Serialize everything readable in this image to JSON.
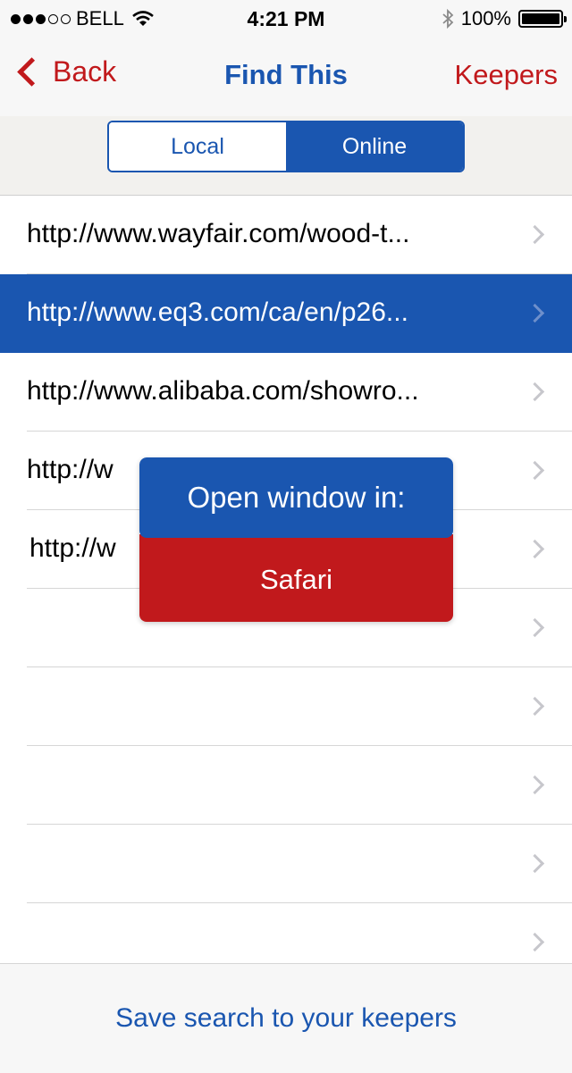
{
  "status_bar": {
    "carrier": "BELL",
    "time": "4:21 PM",
    "battery": "100%",
    "signal_bars_filled": 3,
    "signal_bars_total": 5
  },
  "nav": {
    "back_label": "Back",
    "title": "Find This",
    "keepers_label": "Keepers"
  },
  "segments": {
    "local": "Local",
    "online": "Online",
    "selected": "Online"
  },
  "list": {
    "rows": [
      {
        "url": "http://www.wayfair.com/wood-t..."
      },
      {
        "url": "http://www.eq3.com/ca/en/p26..."
      },
      {
        "url": "http://www.alibaba.com/showro..."
      },
      {
        "url": "http://w                              /1..."
      },
      {
        "url": "http://w                              vie..."
      },
      {
        "url": ""
      },
      {
        "url": ""
      },
      {
        "url": ""
      },
      {
        "url": ""
      },
      {
        "url": ""
      }
    ],
    "selected_index": 1
  },
  "popup": {
    "title": "Open window in:",
    "option": "Safari"
  },
  "footer": {
    "save_label": "Save search to your keepers"
  },
  "colors": {
    "blue": "#1a56b0",
    "red": "#c1191c"
  },
  "icons": [
    "wifi-icon",
    "bluetooth-icon",
    "battery-icon",
    "chevron-left-icon",
    "chevron-right-icon"
  ]
}
